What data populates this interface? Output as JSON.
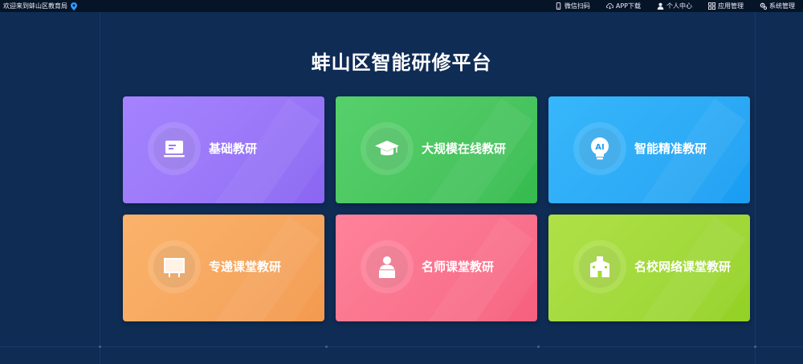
{
  "header": {
    "welcome": "欢迎来到蚌山区教育局",
    "nav": [
      {
        "label": "微信扫码",
        "icon": "phone-icon"
      },
      {
        "label": "APP下载",
        "icon": "cloud-download-icon"
      },
      {
        "label": "个人中心",
        "icon": "user-icon"
      },
      {
        "label": "应用管理",
        "icon": "grid-icon"
      },
      {
        "label": "系统管理",
        "icon": "gear-icon"
      }
    ]
  },
  "main": {
    "title": "蚌山区智能研修平台",
    "cards": [
      {
        "label": "基础教研",
        "icon": "screen-icon",
        "color": "#8f6cf6"
      },
      {
        "label": "大规模在线教研",
        "icon": "graduation-cap-icon",
        "color": "#39c153"
      },
      {
        "label": "智能精准教研",
        "icon": "ai-bulb-icon",
        "color": "#1aa5f6"
      },
      {
        "label": "专递课堂教研",
        "icon": "blackboard-icon",
        "color": "#f6a259"
      },
      {
        "label": "名师课堂教研",
        "icon": "teacher-podium-icon",
        "color": "#fb6a86"
      },
      {
        "label": "名校网络课堂教研",
        "icon": "school-building-icon",
        "color": "#9bd92f"
      }
    ]
  }
}
